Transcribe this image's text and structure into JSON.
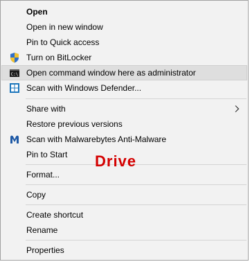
{
  "menu": {
    "items": [
      {
        "label": "Open"
      },
      {
        "label": "Open in new window"
      },
      {
        "label": "Pin to Quick access"
      },
      {
        "label": "Turn on BitLocker",
        "icon": "uac-shield-icon"
      },
      {
        "label": "Open command window here as administrator",
        "icon": "command-prompt-icon"
      },
      {
        "label": "Scan with Windows Defender...",
        "icon": "windows-defender-icon"
      },
      {
        "label": "Share with",
        "submenu": "chevron-right-icon"
      },
      {
        "label": "Restore previous versions"
      },
      {
        "label": "Scan with Malwarebytes Anti-Malware",
        "icon": "malwarebytes-icon"
      },
      {
        "label": "Pin to Start"
      },
      {
        "label": "Format..."
      },
      {
        "label": "Copy"
      },
      {
        "label": "Create shortcut"
      },
      {
        "label": "Rename"
      },
      {
        "label": "Properties"
      }
    ]
  },
  "annotation": {
    "text": "Drive",
    "color": "#d40000"
  },
  "colors": {
    "menu_bg": "#f2f2f2",
    "hover_bg": "#dedede",
    "separator": "#d4d4d4"
  }
}
